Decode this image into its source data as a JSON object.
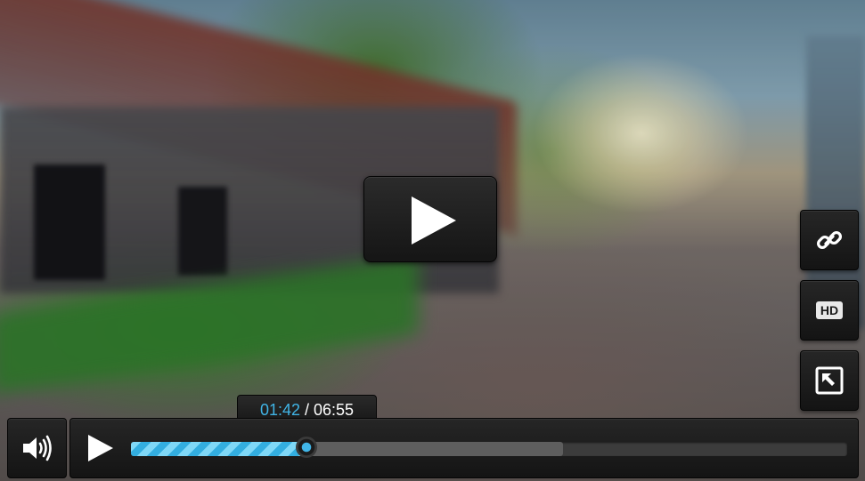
{
  "player": {
    "current_time": "01:42",
    "separator": " / ",
    "duration": "06:55",
    "progress_played_fraction": 0.245,
    "progress_buffered_fraction": 0.603,
    "hd_label": "HD"
  },
  "icons": {
    "big_play": "play-icon",
    "link": "link-icon",
    "hd": "hd-icon",
    "exit_fullscreen": "arrow-up-left-icon",
    "volume": "volume-icon",
    "play": "play-icon"
  },
  "colors": {
    "accent": "#40b4e6",
    "accent_light": "#7fd8f7",
    "control_bg": "#1e1e1e",
    "buffered": "#5e5e5e",
    "track": "#3c3c3c"
  }
}
